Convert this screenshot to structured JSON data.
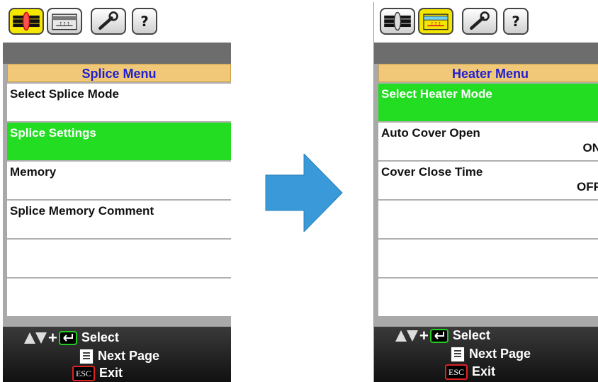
{
  "left_screen": {
    "menu_title": "Splice Menu",
    "rows": [
      {
        "label": "Select Splice Mode",
        "value": "",
        "selected": false
      },
      {
        "label": "Splice Settings",
        "value": "",
        "selected": true
      },
      {
        "label": "Memory",
        "value": "",
        "selected": false
      },
      {
        "label": "Splice Memory Comment",
        "value": "",
        "selected": false
      },
      {
        "label": "",
        "value": "",
        "selected": false
      },
      {
        "label": "",
        "value": "",
        "selected": false
      }
    ],
    "active_tab": "splice-tab",
    "footer": {
      "select": "Select",
      "next_page": "Next Page",
      "exit": "Exit",
      "esc_key": "ESC",
      "plus": "+"
    }
  },
  "right_screen": {
    "menu_title": "Heater Menu",
    "rows": [
      {
        "label": "Select Heater Mode",
        "value": "",
        "selected": true
      },
      {
        "label": "Auto Cover Open",
        "value": "ON",
        "selected": false
      },
      {
        "label": "Cover Close Time",
        "value": "OFF",
        "selected": false
      },
      {
        "label": "",
        "value": "",
        "selected": false
      },
      {
        "label": "",
        "value": "",
        "selected": false
      },
      {
        "label": "",
        "value": "",
        "selected": false
      }
    ],
    "active_tab": "heater-tab",
    "footer": {
      "select": "Select",
      "next_page": "Next Page",
      "exit": "Exit",
      "esc_key": "ESC",
      "plus": "+"
    }
  },
  "tabs": [
    {
      "icon": "splice-icon"
    },
    {
      "icon": "heater-icon"
    },
    {
      "icon": "wrench-icon"
    },
    {
      "icon": "help-icon",
      "label": "?"
    }
  ],
  "colors": {
    "selected_row": "#22dd22",
    "menu_title_bg": "#f0c878",
    "menu_title_text": "#2020d0",
    "active_tab": "#f5e600",
    "arrow": "#3a9ad9",
    "enter_key": "#22cc22",
    "esc_key": "#dd2222"
  }
}
